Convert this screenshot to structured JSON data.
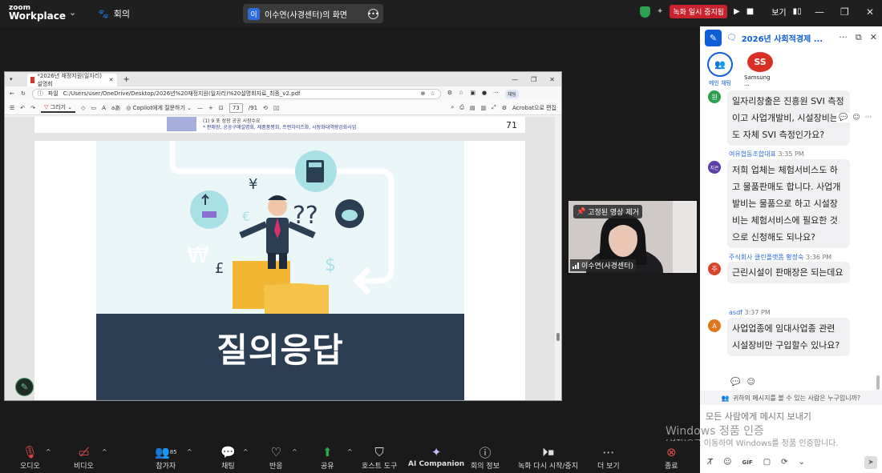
{
  "topbar": {
    "logo_line1": "zoom",
    "logo_line2": "Workplace",
    "meeting_label": "회의",
    "share_avatar": "이",
    "share_title": "이수연(사경센터)의 화면",
    "rec_status": "녹화 일시 중지됨",
    "view_label": "보기"
  },
  "browser": {
    "tab_title": "*2026년 재정지원(일자리) 설명회",
    "file_label": "파일",
    "address": "C:/Users/user/OneDrive/Desktop/2026년%20재정지원(일자리)%20설명회자료_최종_v2.pdf",
    "ai_chip": "채팅",
    "draw_label": "그리기",
    "copilot_label": "Copilot에게 질문하기",
    "page_current": "73",
    "page_total": "/91",
    "acrobat_label": "Acrobat으로 편집",
    "aa_label": "aあ"
  },
  "pdf": {
    "prev_page_line1": "(1) 9 포 성장 공공 시장수요",
    "prev_page_line2": "* 판매장, 공공구매설명회, 제품품평회, 프랜차이즈화, 시장화대역량강화사업",
    "prev_page_number": "71",
    "slide_title": "질의응답"
  },
  "video": {
    "pin_label": "고정된 영상 제거",
    "participant_name": "이수연(사경센터)"
  },
  "chat": {
    "title": "2026년 사회적경제 ...",
    "channels": [
      {
        "label": "메인 채팅",
        "avatar": ""
      },
      {
        "label": "Samsung ...",
        "avatar": "SS"
      }
    ],
    "messages": [
      {
        "sender": "",
        "time": "",
        "avatar": "원",
        "avatar_color": "#2e9e4f",
        "text": "일자리창출은 진흥원 SVI 측정이고 사업개발비, 시설장비는 도 자체 SVI 측정인가요?"
      },
      {
        "sender": "여유협동조합대표",
        "time": "3:35 PM",
        "avatar": "지은",
        "avatar_color": "#5b3ea8",
        "text": "저희 업체는 체험서비스도 하고 물품판매도 합니다. 사업개발비는 물품으로 하고 시설장비는 체험서비스에 필요한 것으로 신청해도 되나요?"
      },
      {
        "sender": "주식회사 클린플랫폼 황정숙",
        "time": "3:36 PM",
        "avatar": "주",
        "avatar_color": "#d9452b",
        "text": "근린시설이 판매장은 되는데요"
      },
      {
        "sender": "asdf",
        "time": "3:37 PM",
        "avatar": "A",
        "avatar_color": "#e0771b",
        "text": "사업업종에 임대사업종 관련 시설장비만 구입할수 있나요?"
      }
    ],
    "who_can_see": "귀하의 메시지를 볼 수 있는 사람은 누구입니까?",
    "input_placeholder": "모든 사람에게 메시지 보내기",
    "gif_label": "GIF"
  },
  "watermark": {
    "line1": "Windows 정품 인증",
    "line2": "[설정]으로 이동하여 Windows를 정품 인증합니다."
  },
  "toolbar": {
    "audio": "오디오",
    "video": "비디오",
    "participants": "참가자",
    "participants_count": "85",
    "chat": "채팅",
    "reactions": "반응",
    "share": "공유",
    "host_tools": "호스트 도구",
    "ai_companion": "AI Companion",
    "meeting_info": "회의 정보",
    "recording": "녹화 다시 시작/중지",
    "more": "더 보기",
    "end": "종료"
  }
}
